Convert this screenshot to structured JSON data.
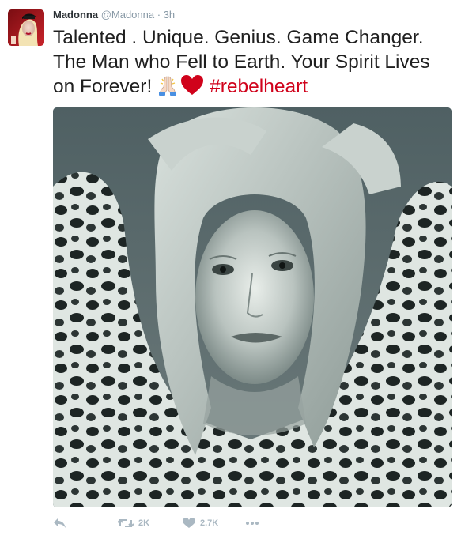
{
  "tweet": {
    "name": "Madonna",
    "handle": "@Madonna",
    "separator": "·",
    "time": "3h",
    "text_line_1": "Talented . Unique. Genius. Game Changer.",
    "text_line_2": "The Man who Fell to Earth. Your Spirit Lives",
    "text_line_3": "on Forever!",
    "hashtag": "#rebelheart",
    "emojis": [
      "folded-hands-icon",
      "red-heart-icon"
    ]
  },
  "actions": {
    "reply_icon": "reply-icon",
    "retweet_icon": "retweet-icon",
    "retweet_count": "2K",
    "like_icon": "heart-icon",
    "like_count": "2.7K",
    "more_icon": "more-icon"
  },
  "colors": {
    "hashtag": "#d0021b",
    "muted": "#8899a6",
    "action": "#aab8c2"
  }
}
